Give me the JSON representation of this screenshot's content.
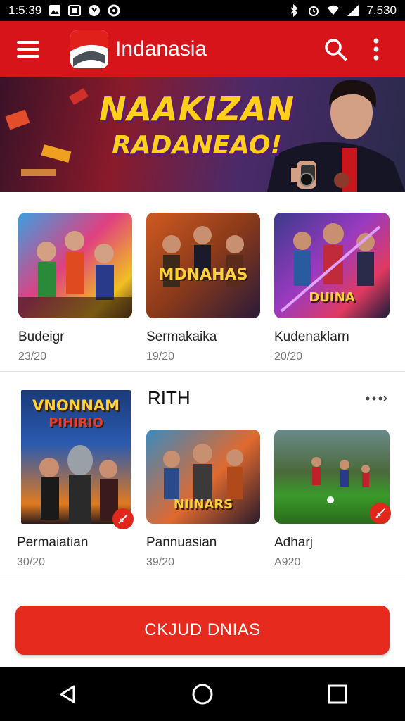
{
  "status_bar": {
    "time": "1:5:39",
    "battery_text": "7.530",
    "left_icons": [
      "image-icon",
      "tv-icon",
      "whatsapp-icon",
      "circle-app-icon"
    ],
    "right_icons": [
      "bluetooth-icon",
      "alarm-icon",
      "wifi-icon",
      "signal-icon"
    ]
  },
  "app_bar": {
    "title": "Indanasia",
    "color": "#d8141b",
    "icons": [
      "menu-icon",
      "search-icon",
      "more-vert-icon"
    ]
  },
  "banner": {
    "line1": "NAAKIZAN",
    "line2": "RADANEAO!"
  },
  "section1": {
    "items": [
      {
        "title": "Budeigr",
        "subtitle": "23/20"
      },
      {
        "title": "Sermakaika",
        "subtitle": "19/20"
      },
      {
        "title": "Kudenaklarn",
        "subtitle": "20/20"
      }
    ],
    "thumb_texts": [
      "",
      "MDNAHAS",
      "DUINA"
    ]
  },
  "section2": {
    "header": "RITH",
    "featured": {
      "thumb_text1": "VNONNAM",
      "thumb_text2": "PIHIRIO"
    },
    "items": [
      {
        "title": "Permaiatian",
        "subtitle": "30/20"
      },
      {
        "title": "Pannuasian",
        "subtitle": "39/20"
      },
      {
        "title": "Adharj",
        "subtitle": "A920"
      }
    ],
    "thumb_texts": [
      "NIINARS"
    ]
  },
  "cta": {
    "label": "CKJUD DNIAS"
  },
  "nav_bar": {
    "icons": [
      "back-icon",
      "home-icon",
      "recents-icon"
    ]
  }
}
